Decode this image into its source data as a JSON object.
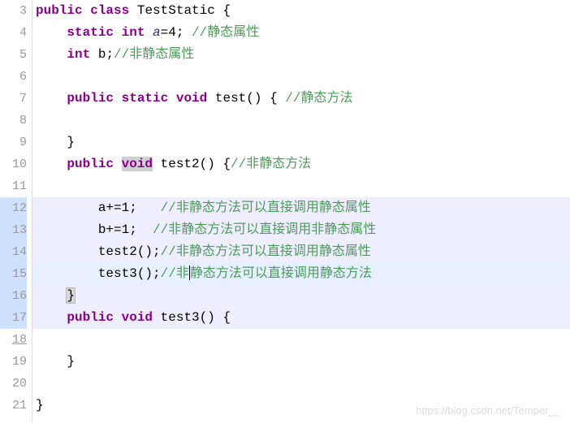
{
  "watermark": "https://blog.csdn.net/Temper__",
  "line_numbers": [
    "3",
    "4",
    "5",
    "6",
    "7",
    "8",
    "9",
    "10",
    "11",
    "12",
    "13",
    "14",
    "15",
    "16",
    "17",
    "18",
    "19",
    "20",
    "21"
  ],
  "tokens": {
    "public": "public",
    "class": "class",
    "static": "static",
    "int": "int",
    "void": "void",
    "TestStatic": "TestStatic",
    "a": "a",
    "eq4": "=4;",
    "b": "b",
    "semi": ";",
    "test": "test",
    "test2": "test2",
    "test3": "test3",
    "parens_empty": "()",
    "lbrace": "{",
    "rbrace": "}",
    "a_inc": "a+=1;",
    "b_inc": "b+=1;",
    "call_test2": "test2();",
    "call_test3": "test3();"
  },
  "comments": {
    "c4": " //静态属性",
    "c5": "//非静态属性",
    "c7": "//静态方法",
    "c10": "//非静态方法",
    "c12": "//非静态方法可以直接调用静态属性",
    "c13": "//非静态方法可以直接调用非静态属性",
    "c14": "//非静态方法可以直接调用静态属性",
    "c15a": "//非",
    "c15b": "静态方法可以直接调用静态方法"
  },
  "chart_data": {
    "type": "table",
    "language": "Java",
    "class_name": "TestStatic",
    "fields": [
      {
        "name": "a",
        "type": "int",
        "static": true,
        "initializer": 4,
        "comment": "静态属性"
      },
      {
        "name": "b",
        "type": "int",
        "static": false,
        "initializer": null,
        "comment": "非静态属性"
      }
    ],
    "methods": [
      {
        "name": "test",
        "static": true,
        "return": "void",
        "comment": "静态方法",
        "body": []
      },
      {
        "name": "test2",
        "static": false,
        "return": "void",
        "comment": "非静态方法",
        "body": [
          {
            "stmt": "a+=1;",
            "comment": "非静态方法可以直接调用静态属性"
          },
          {
            "stmt": "b+=1;",
            "comment": "非静态方法可以直接调用非静态属性"
          },
          {
            "stmt": "test2();",
            "comment": "非静态方法可以直接调用静态属性"
          },
          {
            "stmt": "test3();",
            "comment": "非静态方法可以直接调用静态方法"
          }
        ]
      },
      {
        "name": "test3",
        "static": false,
        "return": "void",
        "comment": null,
        "body": []
      }
    ],
    "highlighted_lines": [
      12,
      13,
      14,
      15,
      16,
      17
    ],
    "cursor_line": 15
  }
}
